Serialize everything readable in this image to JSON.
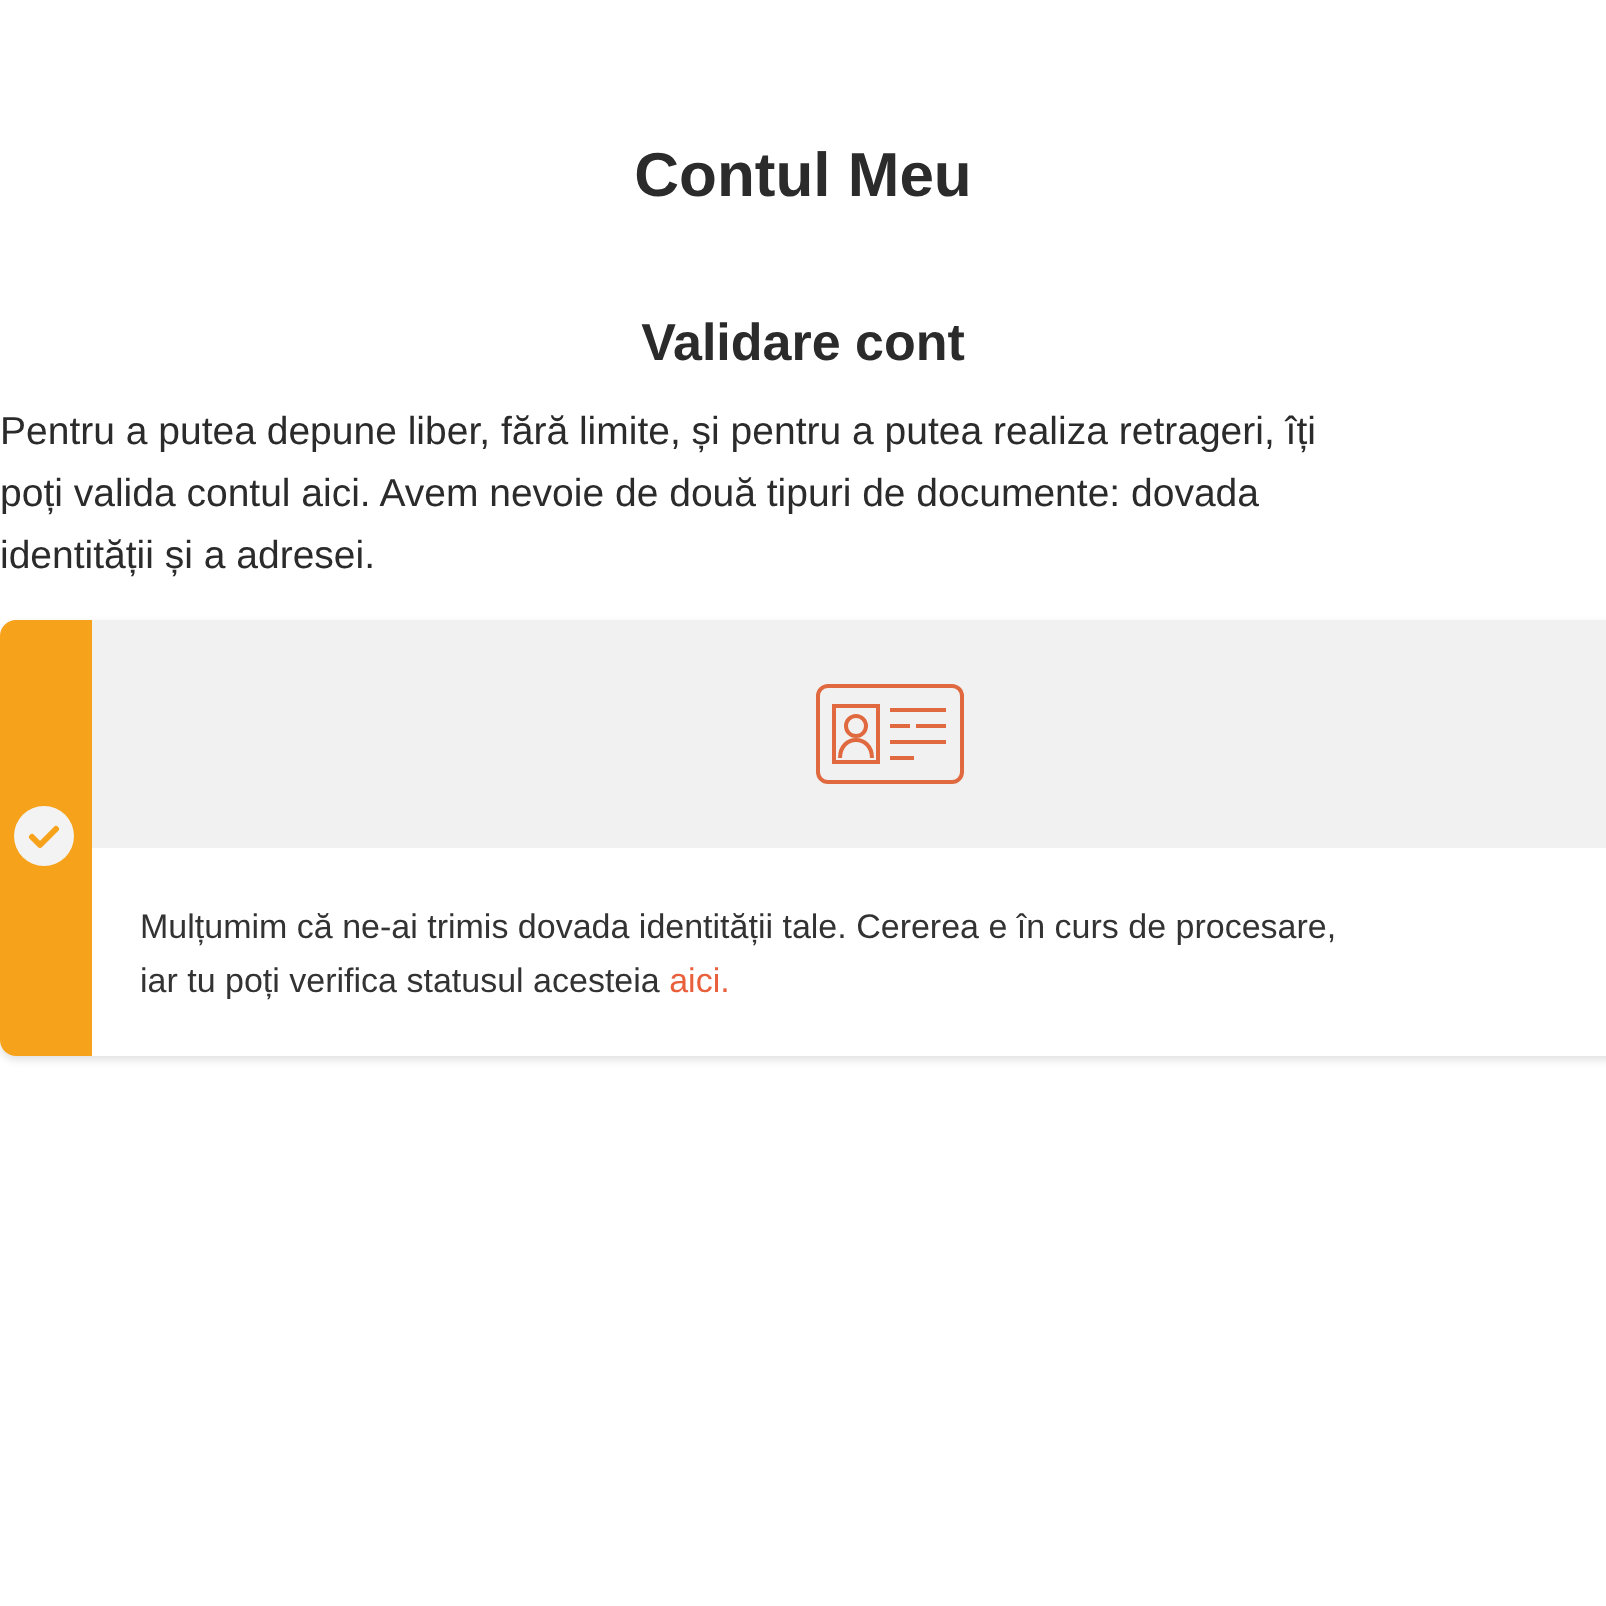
{
  "page_title": "Contul Meu",
  "section_title": "Validare cont",
  "intro_lines": [
    "Pentru a putea depune liber, fără limite, și pentru a putea realiza retrageri, îți",
    "poți valida contul aici. Avem nevoie de două tipuri de documente: dovada",
    "identității și a adresei."
  ],
  "document_card": {
    "checked": true,
    "message_lines": [
      "Mulțumim că ne-ai trimis dovada identității tale. Cererea e în curs de procesare,",
      "iar tu poți verifica statusul acesteia"
    ],
    "link": "aici."
  }
}
